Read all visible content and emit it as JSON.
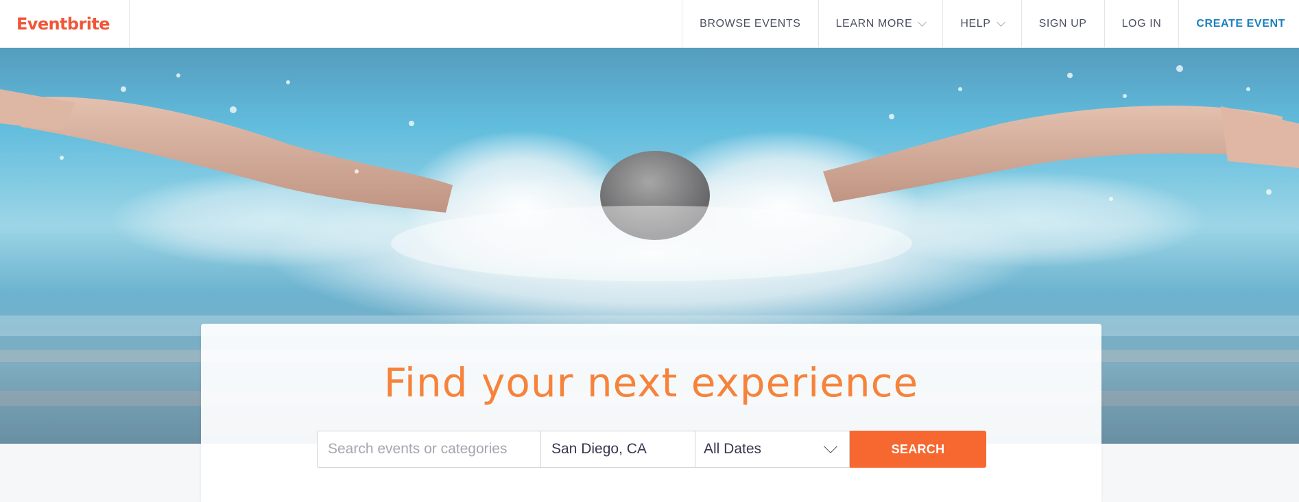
{
  "header": {
    "logo": "Eventbrite",
    "nav": [
      {
        "label": "BROWSE EVENTS",
        "has_dropdown": false
      },
      {
        "label": "LEARN MORE",
        "has_dropdown": true
      },
      {
        "label": "HELP",
        "has_dropdown": true
      },
      {
        "label": "SIGN UP",
        "has_dropdown": false
      },
      {
        "label": "LOG IN",
        "has_dropdown": false
      },
      {
        "label": "CREATE EVENT",
        "has_dropdown": false
      }
    ]
  },
  "hero": {
    "image_icon": "swimmer-butterfly-image"
  },
  "search": {
    "title": "Find your next experience",
    "keyword_placeholder": "Search events or categories",
    "keyword_value": "",
    "location_value": "San Diego, CA",
    "dates_value": "All Dates",
    "button_label": "SEARCH"
  },
  "colors": {
    "brand": "#f05537",
    "title": "#f6833c",
    "search_button": "#f6682f",
    "create_event": "#1a7fbf"
  }
}
